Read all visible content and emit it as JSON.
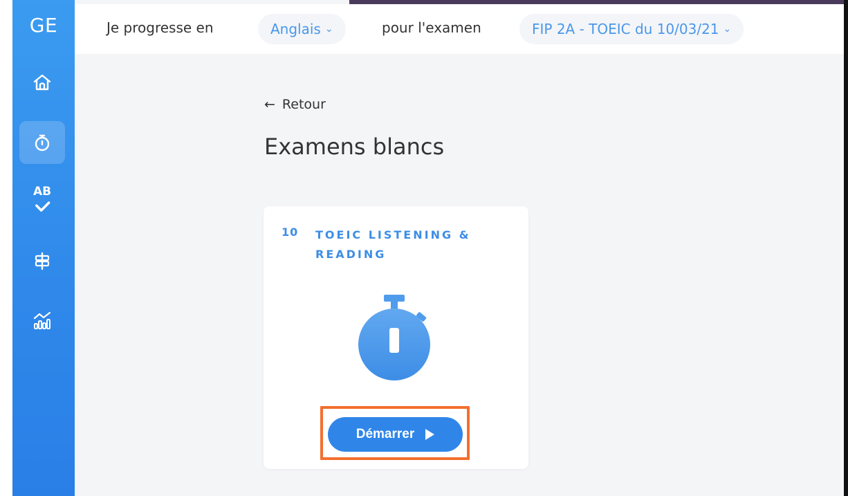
{
  "sidebar": {
    "brand": "GE",
    "items": [
      {
        "name": "home",
        "icon": "home-icon"
      },
      {
        "name": "timer",
        "icon": "stopwatch-icon",
        "active": true
      },
      {
        "name": "vocabulary",
        "icon": "ab-check-icon",
        "label": "AB"
      },
      {
        "name": "signpost",
        "icon": "signpost-icon"
      },
      {
        "name": "stats",
        "icon": "chart-icon"
      }
    ]
  },
  "topbar": {
    "prefix": "Je progresse en",
    "language": "Anglais",
    "middle": "pour l'examen",
    "exam": "FIP 2A - TOEIC du 10/03/21"
  },
  "main": {
    "back_label": "Retour",
    "title": "Examens blancs",
    "card": {
      "number": "10",
      "title": "TOEIC LISTENING & READING",
      "icon": "stopwatch-icon",
      "start_label": "Démarrer"
    }
  },
  "colors": {
    "accent": "#2f86e8",
    "sidebar": "#3b9bf0",
    "highlight": "#f36f2f"
  }
}
